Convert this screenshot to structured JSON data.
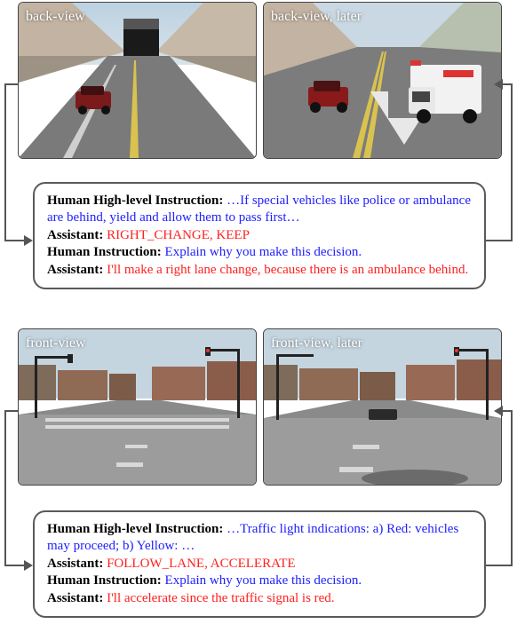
{
  "scene1": {
    "img_left_label": "back-view",
    "img_right_label": "back-view, later",
    "dialogue": {
      "human_hli_key": "Human High-level Instruction: ",
      "human_hli_text": "…If special vehicles like police or ambulance are behind, yield and allow them to pass first…",
      "assist1_key": "Assistant: ",
      "assist1_text": "RIGHT_CHANGE, KEEP",
      "human2_key": "Human Instruction: ",
      "human2_text": "Explain why you make this decision.",
      "assist2_key": "Assistant: ",
      "assist2_text": "I'll make a right lane change, because there is an ambulance behind."
    }
  },
  "scene2": {
    "img_left_label": "front-view",
    "img_right_label": "front-view, later",
    "dialogue": {
      "human_hli_key": "Human High-level Instruction: ",
      "human_hli_text": "…Traffic light indications: a) Red: vehicles may proceed; b) Yellow: …",
      "assist1_key": "Assistant: ",
      "assist1_text": "FOLLOW_LANE, ACCELERATE",
      "human2_key": "Human Instruction: ",
      "human2_text": "Explain why you make this decision.",
      "assist2_key": "Assistant: ",
      "assist2_text": "I'll accelerate since the traffic signal is red."
    }
  }
}
